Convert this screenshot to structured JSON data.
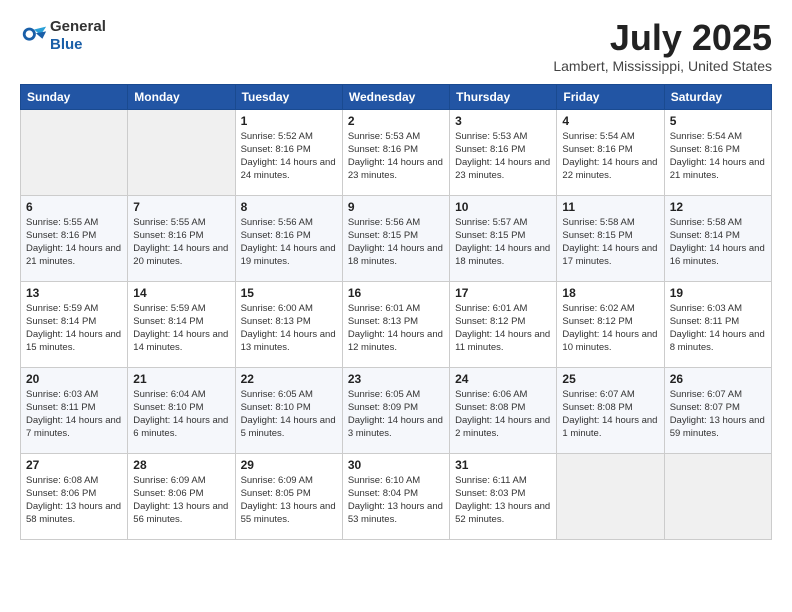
{
  "header": {
    "logo_general": "General",
    "logo_blue": "Blue",
    "month": "July 2025",
    "location": "Lambert, Mississippi, United States"
  },
  "days_of_week": [
    "Sunday",
    "Monday",
    "Tuesday",
    "Wednesday",
    "Thursday",
    "Friday",
    "Saturday"
  ],
  "weeks": [
    [
      {
        "day": "",
        "info": ""
      },
      {
        "day": "",
        "info": ""
      },
      {
        "day": "1",
        "info": "Sunrise: 5:52 AM\nSunset: 8:16 PM\nDaylight: 14 hours\nand 24 minutes."
      },
      {
        "day": "2",
        "info": "Sunrise: 5:53 AM\nSunset: 8:16 PM\nDaylight: 14 hours\nand 23 minutes."
      },
      {
        "day": "3",
        "info": "Sunrise: 5:53 AM\nSunset: 8:16 PM\nDaylight: 14 hours\nand 23 minutes."
      },
      {
        "day": "4",
        "info": "Sunrise: 5:54 AM\nSunset: 8:16 PM\nDaylight: 14 hours\nand 22 minutes."
      },
      {
        "day": "5",
        "info": "Sunrise: 5:54 AM\nSunset: 8:16 PM\nDaylight: 14 hours\nand 21 minutes."
      }
    ],
    [
      {
        "day": "6",
        "info": "Sunrise: 5:55 AM\nSunset: 8:16 PM\nDaylight: 14 hours\nand 21 minutes."
      },
      {
        "day": "7",
        "info": "Sunrise: 5:55 AM\nSunset: 8:16 PM\nDaylight: 14 hours\nand 20 minutes."
      },
      {
        "day": "8",
        "info": "Sunrise: 5:56 AM\nSunset: 8:16 PM\nDaylight: 14 hours\nand 19 minutes."
      },
      {
        "day": "9",
        "info": "Sunrise: 5:56 AM\nSunset: 8:15 PM\nDaylight: 14 hours\nand 18 minutes."
      },
      {
        "day": "10",
        "info": "Sunrise: 5:57 AM\nSunset: 8:15 PM\nDaylight: 14 hours\nand 18 minutes."
      },
      {
        "day": "11",
        "info": "Sunrise: 5:58 AM\nSunset: 8:15 PM\nDaylight: 14 hours\nand 17 minutes."
      },
      {
        "day": "12",
        "info": "Sunrise: 5:58 AM\nSunset: 8:14 PM\nDaylight: 14 hours\nand 16 minutes."
      }
    ],
    [
      {
        "day": "13",
        "info": "Sunrise: 5:59 AM\nSunset: 8:14 PM\nDaylight: 14 hours\nand 15 minutes."
      },
      {
        "day": "14",
        "info": "Sunrise: 5:59 AM\nSunset: 8:14 PM\nDaylight: 14 hours\nand 14 minutes."
      },
      {
        "day": "15",
        "info": "Sunrise: 6:00 AM\nSunset: 8:13 PM\nDaylight: 14 hours\nand 13 minutes."
      },
      {
        "day": "16",
        "info": "Sunrise: 6:01 AM\nSunset: 8:13 PM\nDaylight: 14 hours\nand 12 minutes."
      },
      {
        "day": "17",
        "info": "Sunrise: 6:01 AM\nSunset: 8:12 PM\nDaylight: 14 hours\nand 11 minutes."
      },
      {
        "day": "18",
        "info": "Sunrise: 6:02 AM\nSunset: 8:12 PM\nDaylight: 14 hours\nand 10 minutes."
      },
      {
        "day": "19",
        "info": "Sunrise: 6:03 AM\nSunset: 8:11 PM\nDaylight: 14 hours\nand 8 minutes."
      }
    ],
    [
      {
        "day": "20",
        "info": "Sunrise: 6:03 AM\nSunset: 8:11 PM\nDaylight: 14 hours\nand 7 minutes."
      },
      {
        "day": "21",
        "info": "Sunrise: 6:04 AM\nSunset: 8:10 PM\nDaylight: 14 hours\nand 6 minutes."
      },
      {
        "day": "22",
        "info": "Sunrise: 6:05 AM\nSunset: 8:10 PM\nDaylight: 14 hours\nand 5 minutes."
      },
      {
        "day": "23",
        "info": "Sunrise: 6:05 AM\nSunset: 8:09 PM\nDaylight: 14 hours\nand 3 minutes."
      },
      {
        "day": "24",
        "info": "Sunrise: 6:06 AM\nSunset: 8:08 PM\nDaylight: 14 hours\nand 2 minutes."
      },
      {
        "day": "25",
        "info": "Sunrise: 6:07 AM\nSunset: 8:08 PM\nDaylight: 14 hours\nand 1 minute."
      },
      {
        "day": "26",
        "info": "Sunrise: 6:07 AM\nSunset: 8:07 PM\nDaylight: 13 hours\nand 59 minutes."
      }
    ],
    [
      {
        "day": "27",
        "info": "Sunrise: 6:08 AM\nSunset: 8:06 PM\nDaylight: 13 hours\nand 58 minutes."
      },
      {
        "day": "28",
        "info": "Sunrise: 6:09 AM\nSunset: 8:06 PM\nDaylight: 13 hours\nand 56 minutes."
      },
      {
        "day": "29",
        "info": "Sunrise: 6:09 AM\nSunset: 8:05 PM\nDaylight: 13 hours\nand 55 minutes."
      },
      {
        "day": "30",
        "info": "Sunrise: 6:10 AM\nSunset: 8:04 PM\nDaylight: 13 hours\nand 53 minutes."
      },
      {
        "day": "31",
        "info": "Sunrise: 6:11 AM\nSunset: 8:03 PM\nDaylight: 13 hours\nand 52 minutes."
      },
      {
        "day": "",
        "info": ""
      },
      {
        "day": "",
        "info": ""
      }
    ]
  ]
}
